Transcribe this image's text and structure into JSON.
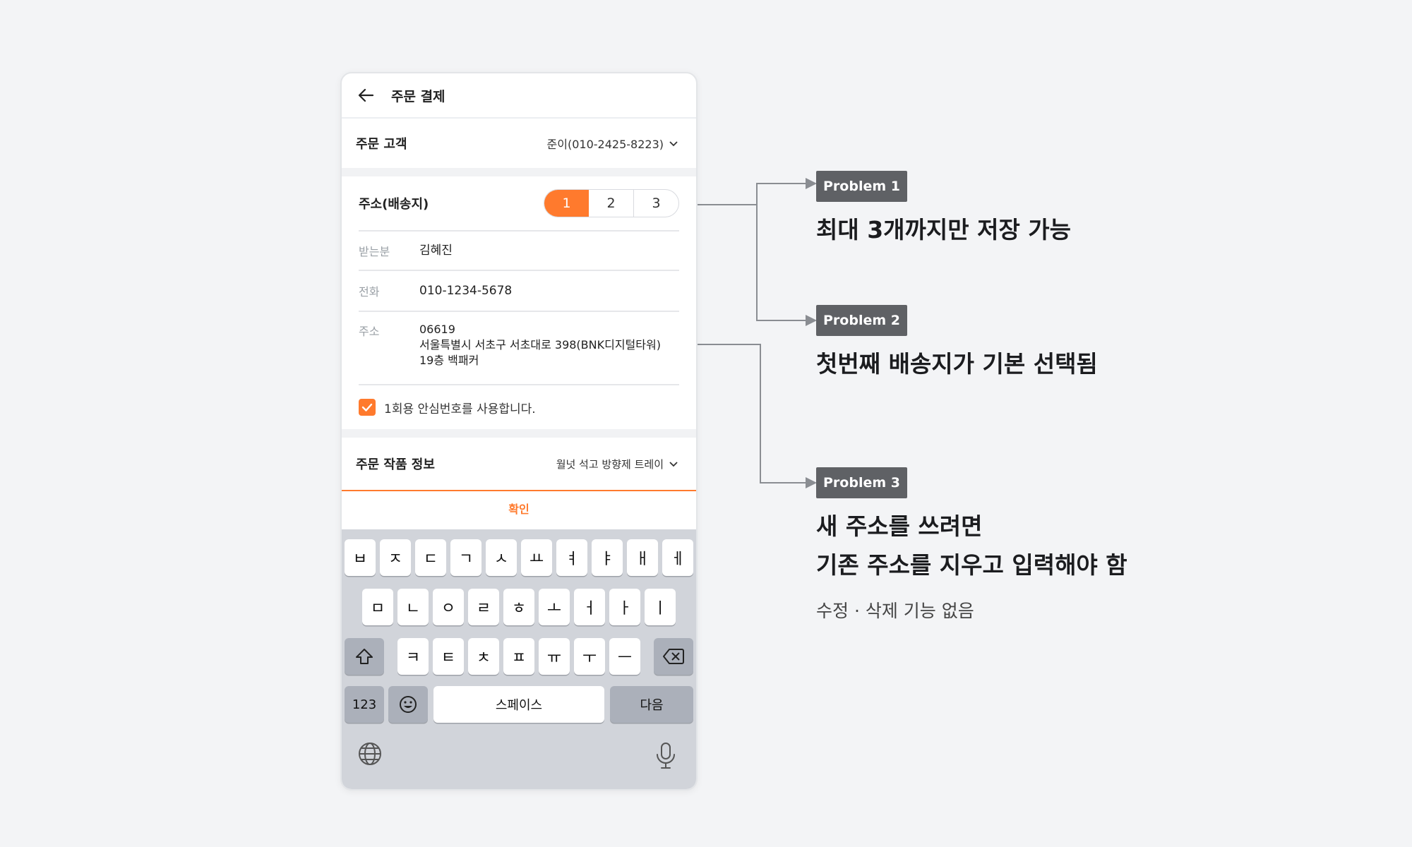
{
  "header": {
    "title": "주문 결제"
  },
  "customer": {
    "label": "주문 고객",
    "value": "준이(010-2425-8223)"
  },
  "address": {
    "label": "주소(배송지)",
    "tabs": [
      "1",
      "2",
      "3"
    ],
    "selected_tab": "1",
    "name_label": "받는분",
    "name_value": "김혜진",
    "phone_label": "전화",
    "phone_value": "010-1234-5678",
    "addr_label": "주소",
    "addr_zip": "06619",
    "addr_line1": "서울특별시 서초구 서초대로 398(BNK디지털타워)",
    "addr_line2": "19층 백패커",
    "safe_number_text": "1회용 안심번호를 사용합니다.",
    "safe_number_checked": true
  },
  "product": {
    "label": "주문 작품 정보",
    "value": "월넛 석고 방향제 트레이"
  },
  "confirm": {
    "label": "확인"
  },
  "keyboard": {
    "row1": [
      "ㅂ",
      "ㅈ",
      "ㄷ",
      "ㄱ",
      "ㅅ",
      "ㅛ",
      "ㅕ",
      "ㅑ",
      "ㅐ",
      "ㅔ"
    ],
    "row2": [
      "ㅁ",
      "ㄴ",
      "ㅇ",
      "ㄹ",
      "ㅎ",
      "ㅗ",
      "ㅓ",
      "ㅏ",
      "ㅣ"
    ],
    "row3": [
      "ㅋ",
      "ㅌ",
      "ㅊ",
      "ㅍ",
      "ㅠ",
      "ㅜ",
      "ㅡ"
    ],
    "numbers_key": "123",
    "space_key": "스페이스",
    "next_key": "다음",
    "icons": [
      "shift-icon",
      "backspace-icon",
      "emoji-icon",
      "globe-icon",
      "mic-icon"
    ]
  },
  "annotations": [
    {
      "badge": "Problem 1",
      "title_lines": [
        "최대 3개까지만 저장 가능"
      ],
      "subtitle": ""
    },
    {
      "badge": "Problem 2",
      "title_lines": [
        "첫번째 배송지가 기본 선택됨"
      ],
      "subtitle": ""
    },
    {
      "badge": "Problem 3",
      "title_lines": [
        "새 주소를 쓰려면",
        "기존 주소를 지우고 입력해야 함"
      ],
      "subtitle": "수정 · 삭제 기능 없음"
    }
  ],
  "colors": {
    "accent": "#ff7a2d",
    "badge": "#5f6165",
    "keyboard_bg": "#d1d4da",
    "page_bg": "#f3f4f6"
  }
}
